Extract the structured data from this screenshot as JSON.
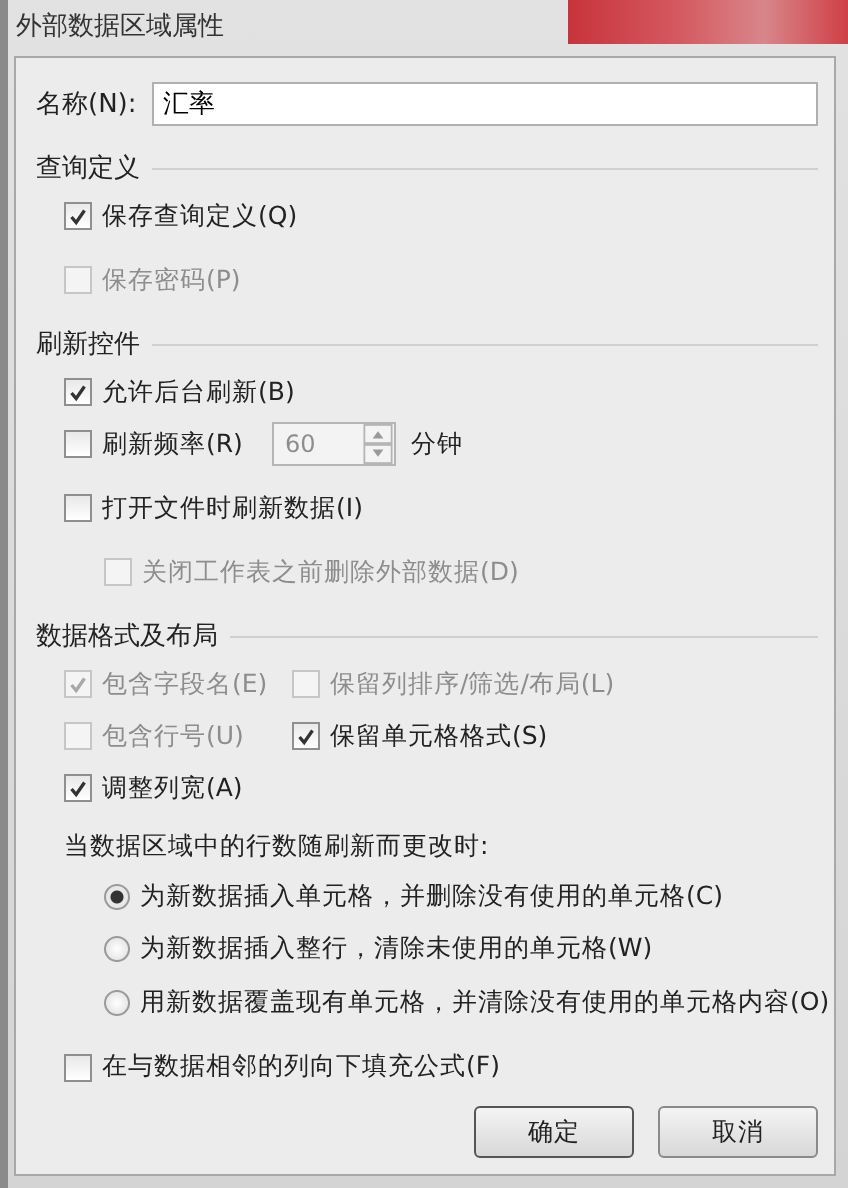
{
  "window": {
    "title": "外部数据区域属性"
  },
  "name_field": {
    "label": "名称(N):",
    "value": "汇率"
  },
  "sections": [
    {
      "title": "查询定义",
      "rows": [
        [
          {
            "kind": "checkbox",
            "label": "保存查询定义(Q)",
            "checked": true,
            "disabled": false
          }
        ],
        [
          {
            "kind": "checkbox",
            "label": "保存密码(P)",
            "checked": false,
            "disabled": true
          }
        ]
      ]
    },
    {
      "title": "刷新控件",
      "rows": [
        [
          {
            "kind": "checkbox",
            "label": "允许后台刷新(B)",
            "checked": true,
            "disabled": false
          }
        ],
        [
          {
            "kind": "spin",
            "label": "刷新频率(R)",
            "checked": false,
            "disabled": false,
            "value": "60",
            "field_disabled": true,
            "unit": "分钟"
          }
        ],
        [
          {
            "kind": "checkbox",
            "label": "打开文件时刷新数据(I)",
            "checked": false,
            "disabled": false,
            "children": [
              {
                "kind": "checkbox",
                "label": "关闭工作表之前删除外部数据(D)",
                "checked": false,
                "disabled": true
              }
            ]
          }
        ]
      ]
    },
    {
      "title": "数据格式及布局",
      "rows": [
        [
          {
            "kind": "checkbox",
            "label": "包含字段名(E)",
            "checked": true,
            "disabled": true
          },
          {
            "kind": "checkbox",
            "label": "保留列排序/筛选/布局(L)",
            "checked": false,
            "disabled": true
          }
        ],
        [
          {
            "kind": "checkbox",
            "label": "包含行号(U)",
            "checked": false,
            "disabled": true
          },
          {
            "kind": "checkbox",
            "label": "保留单元格格式(S)",
            "checked": true,
            "disabled": false
          }
        ],
        [
          {
            "kind": "checkbox",
            "label": "调整列宽(A)",
            "checked": true,
            "disabled": false
          }
        ],
        [
          {
            "kind": "radio_group",
            "label": "当数据区域中的行数随刷新而更改时:",
            "options": [
              {
                "label": "为新数据插入单元格，并删除没有使用的单元格(C)",
                "selected": true
              },
              {
                "label": "为新数据插入整行，清除未使用的单元格(W)",
                "selected": false
              },
              {
                "label": "用新数据覆盖现有单元格，并清除没有使用的单元格内容(O)",
                "selected": false
              }
            ]
          }
        ],
        [
          {
            "kind": "checkbox",
            "label": "在与数据相邻的列向下填充公式(F)",
            "checked": false,
            "disabled": false
          }
        ]
      ]
    }
  ],
  "buttons": [
    {
      "label": "确定",
      "default": true
    },
    {
      "label": "取消",
      "default": false
    }
  ]
}
